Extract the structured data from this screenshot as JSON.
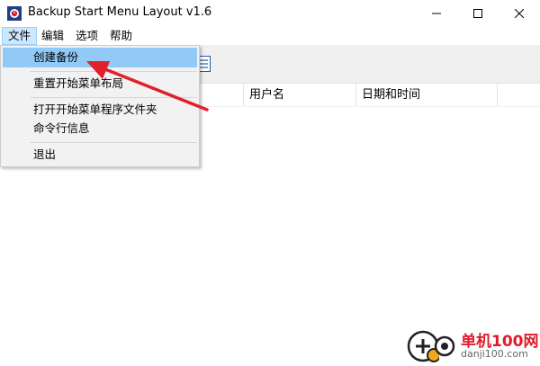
{
  "window": {
    "title": "Backup Start Menu Layout v1.6"
  },
  "menubar": {
    "items": [
      {
        "label": "文件"
      },
      {
        "label": "编辑"
      },
      {
        "label": "选项"
      },
      {
        "label": "帮助"
      }
    ]
  },
  "file_menu": {
    "items": [
      {
        "label": "创建备份"
      },
      {
        "label": "重置开始菜单布局"
      },
      {
        "label": "打开开始菜单程序文件夹"
      },
      {
        "label": "命令行信息"
      },
      {
        "label": "退出"
      }
    ]
  },
  "list": {
    "columns": [
      {
        "label": "用户名"
      },
      {
        "label": "日期和时间"
      }
    ]
  },
  "annotation": {
    "arrow_color": "#e0202a"
  },
  "watermark": {
    "name": "单机100网",
    "url": "danji100.com"
  },
  "colors": {
    "menu_active": "#cce8ff",
    "menu_hover": "#91c9f7",
    "toolbar_bg": "#f0f0f0"
  }
}
